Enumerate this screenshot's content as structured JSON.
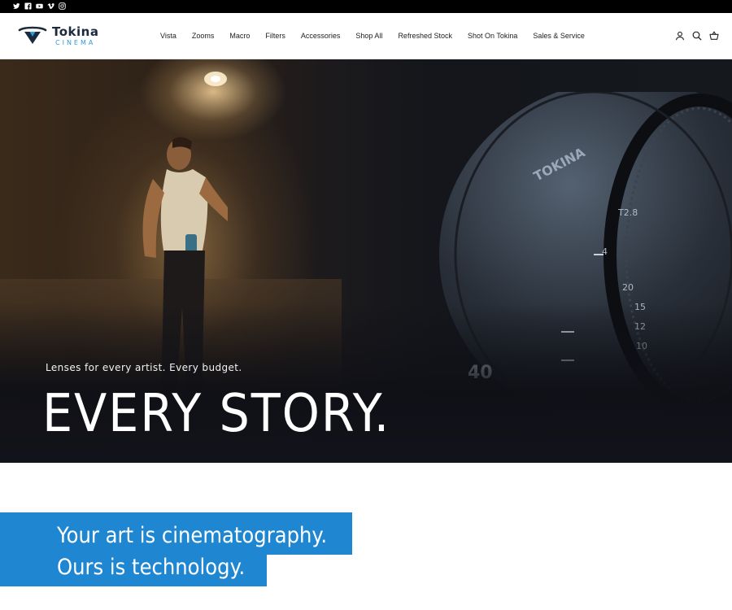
{
  "social": {
    "icons": [
      "twitter-icon",
      "facebook-icon",
      "youtube-icon",
      "vimeo-icon",
      "instagram-icon"
    ]
  },
  "brand": {
    "name": "Tokina",
    "sub": "CINEMA",
    "colors": {
      "dark": "#1b2a3c",
      "accent": "#2a9fd8"
    }
  },
  "nav": {
    "items": [
      "Vista",
      "Zooms",
      "Macro",
      "Filters",
      "Accessories",
      "Shop All",
      "Refreshed Stock",
      "Shot On Tokina",
      "Sales & Service"
    ]
  },
  "header_icons": [
    "account-icon",
    "search-icon",
    "cart-icon"
  ],
  "hero": {
    "subtitle": "Lenses for every artist. Every budget.",
    "title": "EVERY STORY.",
    "lens_labels": {
      "brand": "TOKINA",
      "focal": "40"
    }
  },
  "tagline": {
    "line1": "Your art is cinematography.",
    "line2": "Ours is technology.",
    "color": "#1f86d1"
  }
}
